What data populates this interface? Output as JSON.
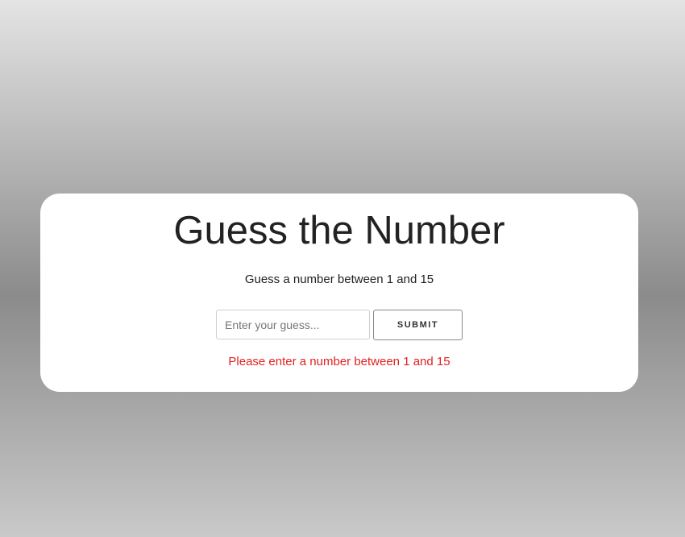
{
  "game": {
    "title": "Guess the Number",
    "subtitle": "Guess a number between 1 and 15",
    "input_placeholder": "Enter your guess...",
    "input_value": "",
    "submit_label": "SUBMIT",
    "error_message": "Please enter a number between 1 and 15"
  },
  "colors": {
    "error": "#e32020",
    "text": "#222222",
    "card_background": "#ffffff"
  }
}
